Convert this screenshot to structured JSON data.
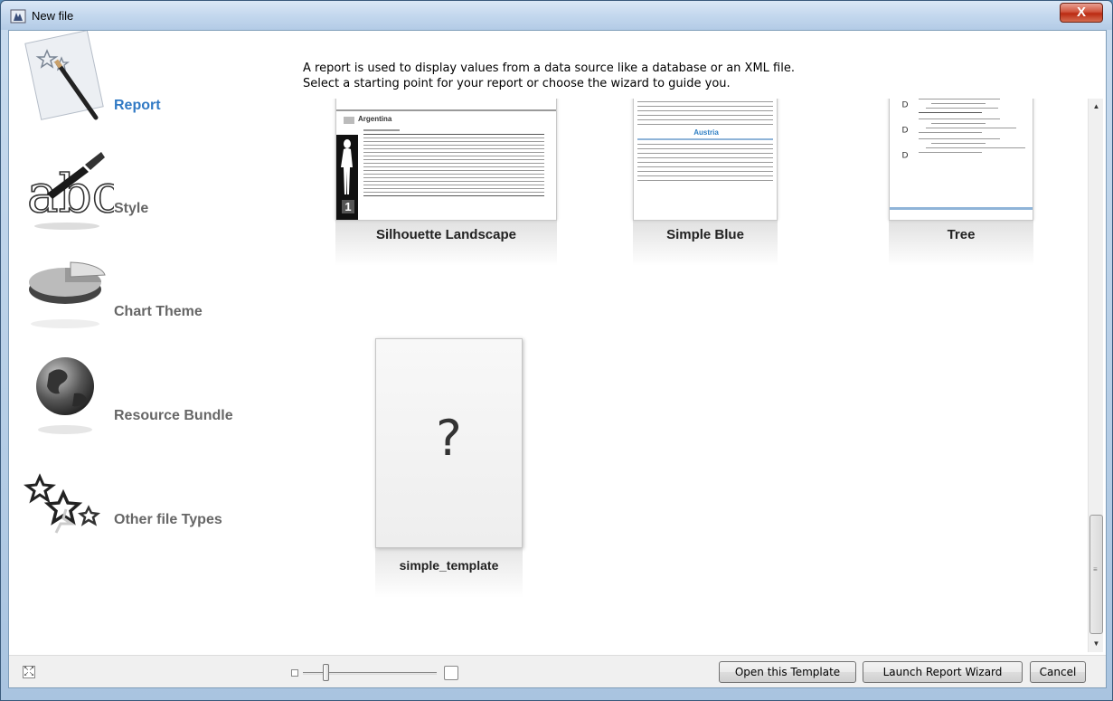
{
  "window": {
    "title": "New file",
    "close_label": "X"
  },
  "sidebar": {
    "items": [
      {
        "label": "Report",
        "icon": "report-pen-icon",
        "active": true
      },
      {
        "label": "Style",
        "icon": "style-brush-icon",
        "active": false
      },
      {
        "label": "Chart Theme",
        "icon": "pie-chart-icon",
        "active": false
      },
      {
        "label": "Resource Bundle",
        "icon": "globe-icon",
        "active": false
      },
      {
        "label": "Other file Types",
        "icon": "stars-icon",
        "active": false
      }
    ]
  },
  "main": {
    "description_line1": "A report is used to display values from a data source like a database or an XML file.",
    "description_line2": "Select a starting point for your report or choose the wizard to guide you.",
    "templates": [
      {
        "label": "Silhouette Landscape"
      },
      {
        "label": "Simple Blue",
        "group_label": "Austria"
      },
      {
        "label": "Tree"
      },
      {
        "label": "simple_template",
        "placeholder_glyph": "?"
      }
    ],
    "silhouette_group_label": "Argentina",
    "silhouette_page_number": "1"
  },
  "bottombar": {
    "open_template_label": "Open this Template",
    "launch_wizard_label": "Launch Report Wizard",
    "cancel_label": "Cancel"
  },
  "colors": {
    "accent": "#3079c4",
    "inactive_label": "#666666"
  }
}
